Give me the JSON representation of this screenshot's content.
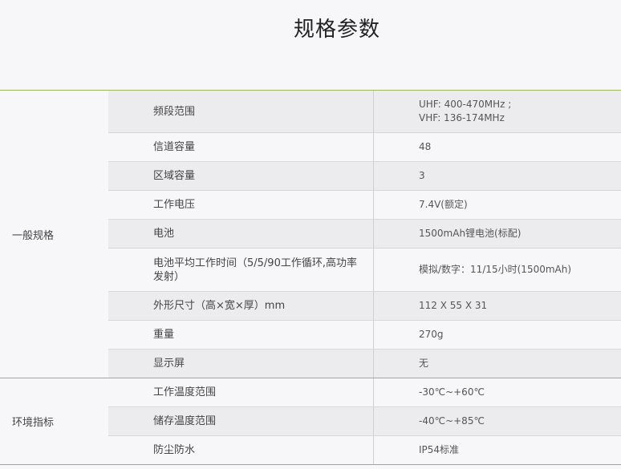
{
  "title": "规格参数",
  "groups": [
    {
      "label": "一般规格",
      "rows": [
        {
          "name": "频段范围",
          "value": "UHF: 400-470MHz ;\nVHF: 136-174MHz"
        },
        {
          "name": "信道容量",
          "value": "48"
        },
        {
          "name": "区域容量",
          "value": "3"
        },
        {
          "name": "工作电压",
          "value": "7.4V(额定)"
        },
        {
          "name": "电池",
          "value": "1500mAh锂电池(标配)"
        },
        {
          "name": "电池平均工作时间（5/5/90工作循环,高功率发射）",
          "value": "模拟/数字：11/15小时(1500mAh)"
        },
        {
          "name": "外形尺寸（高×宽×厚）mm",
          "value": "112 X 55 X 31"
        },
        {
          "name": "重量",
          "value": "270g"
        },
        {
          "name": "显示屏",
          "value": "无"
        }
      ]
    },
    {
      "label": "环境指标",
      "rows": [
        {
          "name": "工作温度范围",
          "value": "-30℃~+60℃"
        },
        {
          "name": "储存温度范围",
          "value": "-40℃~+85℃"
        },
        {
          "name": "防尘防水",
          "value": "IP54标准"
        }
      ]
    }
  ]
}
